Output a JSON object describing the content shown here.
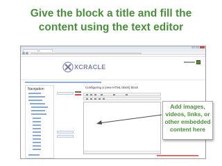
{
  "slide": {
    "title_line1": "Give the block a title and fill the",
    "title_line2": "content using the text editor",
    "accent_color": "#4a8e3c"
  },
  "callout": {
    "line1": "Add images,",
    "line2": "videos, links, or",
    "line3": "other embedded",
    "line4": "content here"
  },
  "screenshot": {
    "logo_text": "XCRACLE",
    "navigation_title": "Navigation",
    "form_heading": "Configuring a (new HTML block) block",
    "icons": [
      "window-close-icon",
      "back-icon",
      "forward-icon",
      "user-avatar-icon",
      "logo-x-icon"
    ]
  }
}
